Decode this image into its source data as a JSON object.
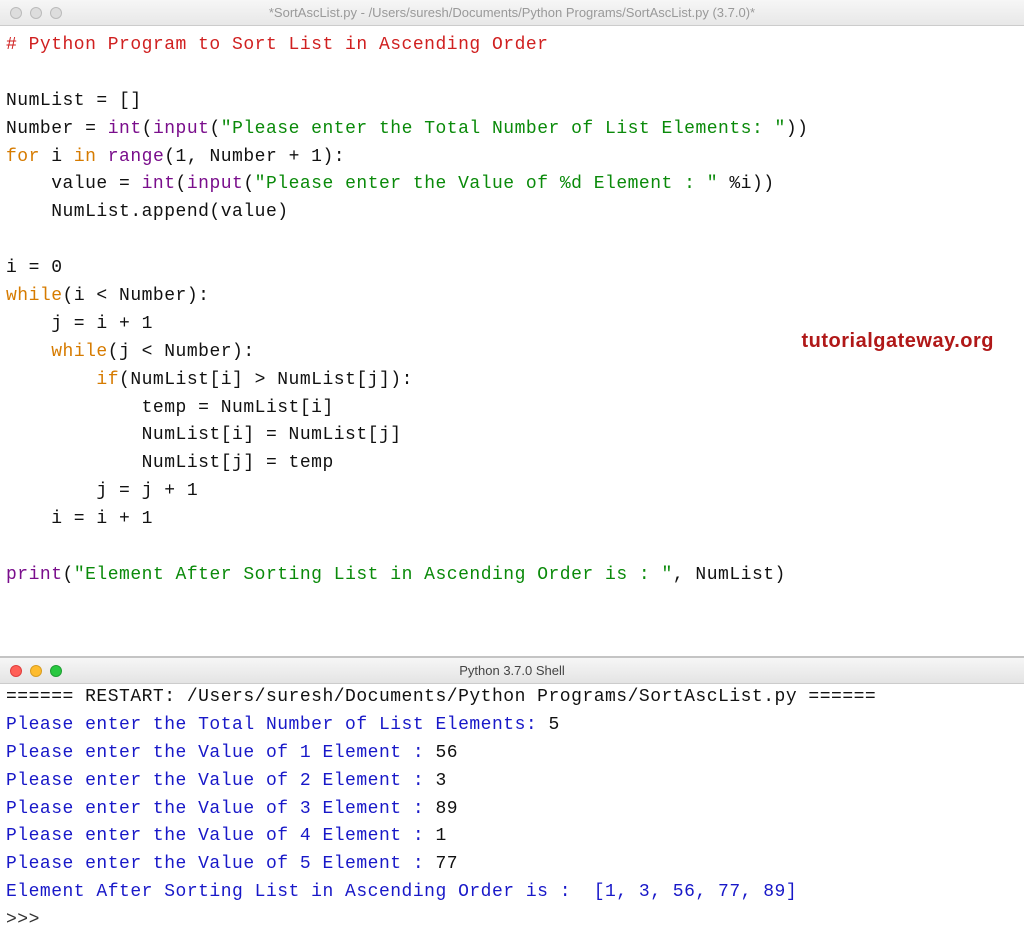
{
  "editor_window": {
    "title": "*SortAscList.py - /Users/suresh/Documents/Python Programs/SortAscList.py (3.7.0)*"
  },
  "code": {
    "comment": "# Python Program to Sort List in Ascending Order",
    "l2": "NumList = []",
    "l3a": "Number = ",
    "l3b": "int",
    "l3c": "(",
    "l3d": "input",
    "l3e": "(",
    "l3f": "\"Please enter the Total Number of List Elements: \"",
    "l3g": "))",
    "l4a": "for",
    "l4b": " i ",
    "l4c": "in",
    "l4d": " ",
    "l4e": "range",
    "l4f": "(1, Number + 1):",
    "l5a": "    value = ",
    "l5b": "int",
    "l5c": "(",
    "l5d": "input",
    "l5e": "(",
    "l5f": "\"Please enter the Value of %d Element : \"",
    "l5g": " %i))",
    "l6": "    NumList.append(value)",
    "l7": "i = 0",
    "l8a": "while",
    "l8b": "(i < Number):",
    "l9": "    j = i + 1",
    "l10a": "    ",
    "l10b": "while",
    "l10c": "(j < Number):",
    "l11a": "        ",
    "l11b": "if",
    "l11c": "(NumList[i] > NumList[j]):",
    "l12": "            temp = NumList[i]",
    "l13": "            NumList[i] = NumList[j]",
    "l14": "            NumList[j] = temp",
    "l15": "        j = j + 1",
    "l16": "    i = i + 1",
    "l17a": "print",
    "l17b": "(",
    "l17c": "\"Element After Sorting List in Ascending Order is : \"",
    "l17d": ", NumList)"
  },
  "watermark": "tutorialgateway.org",
  "shell_window": {
    "title": "Python 3.7.0 Shell"
  },
  "shell": {
    "restart": "====== RESTART: /Users/suresh/Documents/Python Programs/SortAscList.py ======",
    "p1": "Please enter the Total Number of List Elements: ",
    "i1": "5",
    "p2": "Please enter the Value of 1 Element : ",
    "i2": "56",
    "p3": "Please enter the Value of 2 Element : ",
    "i3": "3",
    "p4": "Please enter the Value of 3 Element : ",
    "i4": "89",
    "p5": "Please enter the Value of 4 Element : ",
    "i5": "1",
    "p6": "Please enter the Value of 5 Element : ",
    "i6": "77",
    "result": "Element After Sorting List in Ascending Order is :  [1, 3, 56, 77, 89]",
    "prompt": ">>> "
  }
}
